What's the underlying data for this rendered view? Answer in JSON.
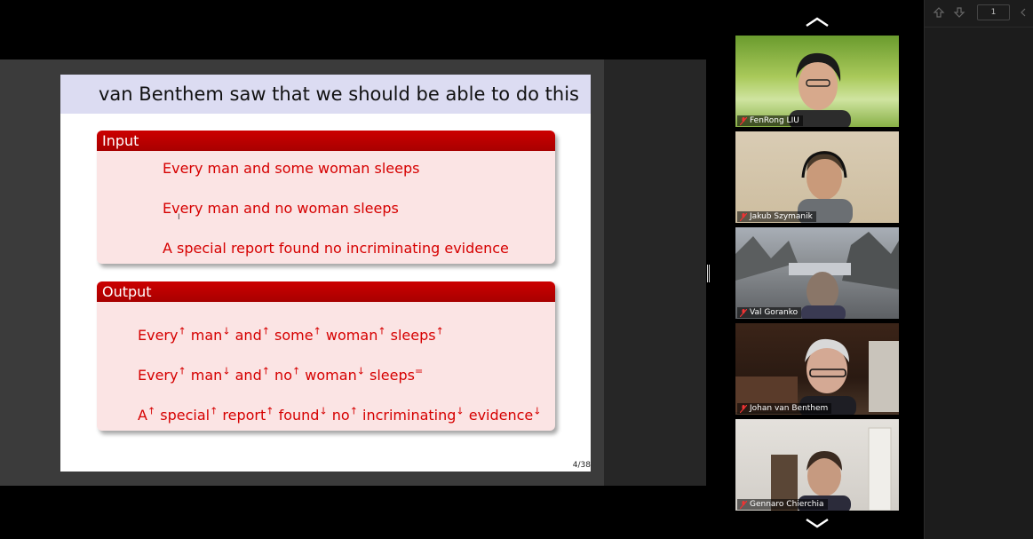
{
  "slide": {
    "title": "van Benthem saw that we should be able to do this",
    "input": {
      "heading": "Input",
      "lines": [
        "Every man and some woman sleeps",
        "Every man and no woman sleeps",
        "A special report found no incriminating evidence"
      ]
    },
    "output": {
      "heading": "Output",
      "lines": [
        [
          [
            "Every",
            "↑"
          ],
          [
            "man",
            "↓"
          ],
          [
            "and",
            "↑"
          ],
          [
            "some",
            "↑"
          ],
          [
            "woman",
            "↑"
          ],
          [
            "sleeps",
            "↑"
          ]
        ],
        [
          [
            "Every",
            "↑"
          ],
          [
            "man",
            "↓"
          ],
          [
            "and",
            "↑"
          ],
          [
            "no",
            "↑"
          ],
          [
            "woman",
            "↓"
          ],
          [
            "sleeps",
            "="
          ]
        ],
        [
          [
            "A",
            "↑"
          ],
          [
            "special",
            "↑"
          ],
          [
            "report",
            "↑"
          ],
          [
            "found",
            "↓"
          ],
          [
            "no",
            "↑"
          ],
          [
            "incriminating",
            "↓"
          ],
          [
            "evidence",
            "↓"
          ]
        ]
      ]
    },
    "page_number": "4/38",
    "cursor_glyph": "I"
  },
  "participants": [
    {
      "name": "FenRong LIU",
      "mic": "muted"
    },
    {
      "name": "Jakub Szymanik",
      "mic": "muted"
    },
    {
      "name": "Val Goranko",
      "mic": "muted"
    },
    {
      "name": "Johan van Benthem",
      "mic": "muted"
    },
    {
      "name": "Gennaro Chierchia",
      "mic": "muted"
    }
  ],
  "side_panel": {
    "page_field": "1",
    "icons": [
      "arrow-up-icon",
      "arrow-down-icon",
      "chevron-left-icon"
    ]
  },
  "gallery_nav": {
    "up_icon": "chevron-up-icon",
    "down_icon": "chevron-down-icon"
  },
  "colors": {
    "slide_red": "#d60000",
    "block_header": "#b30000",
    "block_bg": "#fbe4e4",
    "title_bar": "#dcdcf2"
  }
}
